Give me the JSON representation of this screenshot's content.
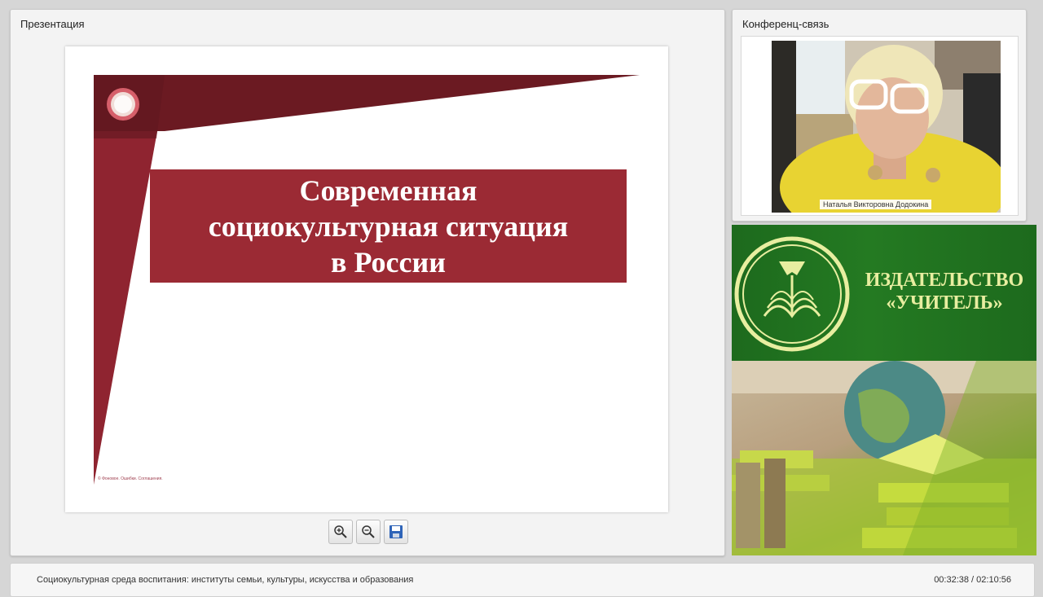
{
  "presentation": {
    "title": "Презентация",
    "slide": {
      "title_lines": [
        "Современная",
        "социокультурная ситуация",
        "в России"
      ],
      "copyright": "© Фоновое. Ошибки. Соглашения."
    },
    "toolbar": {
      "zoom_in": "zoom-in-icon",
      "zoom_out": "zoom-out-icon",
      "save": "save-icon"
    }
  },
  "conference": {
    "title": "Конференц-связь",
    "speaker_name": "Наталья Викторовна Додокина"
  },
  "ad": {
    "publisher_line1": "ИЗДАТЕЛЬСТВО",
    "publisher_line2": "«УЧИТЕЛЬ»"
  },
  "status": {
    "course_title": "Социокультурная среда воспитания: институты семьи, культуры, искусства и образования",
    "time": "00:32:38 / 02:10:56"
  },
  "colors": {
    "slide_accent": "#9b2a34",
    "slide_dark": "#6b1a22",
    "ad_green": "#1d6a1d",
    "ad_text": "#e8eea0"
  }
}
